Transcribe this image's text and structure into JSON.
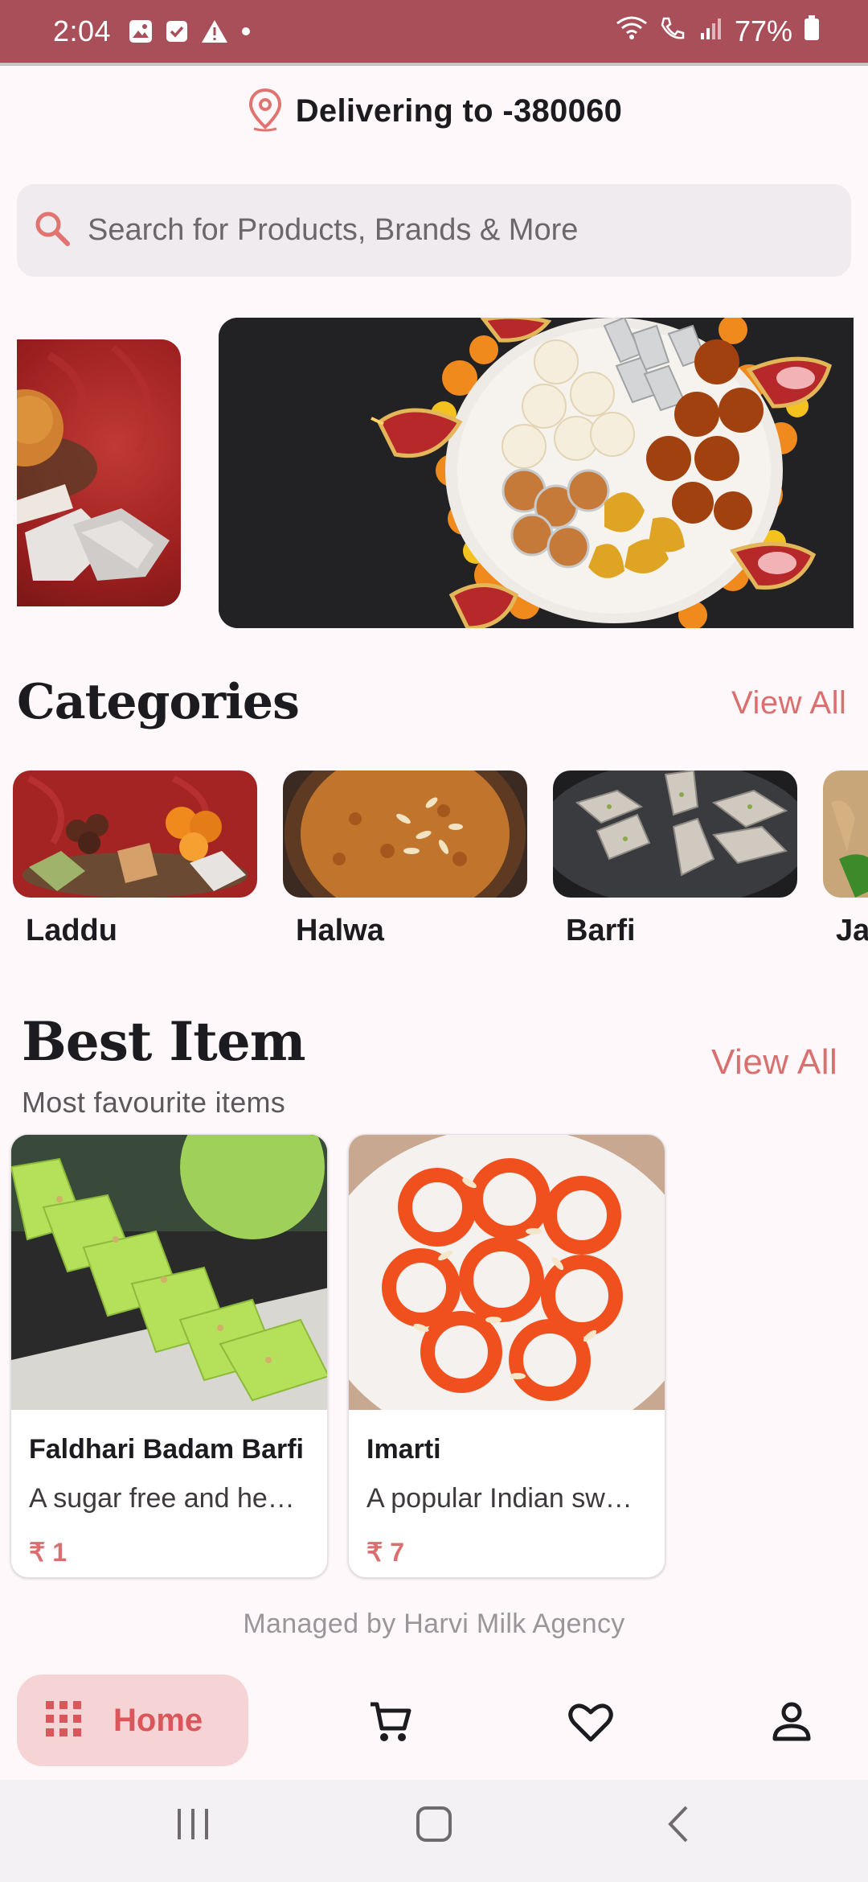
{
  "status_bar": {
    "time": "2:04",
    "battery": "77%",
    "left_icons": [
      "gallery-icon",
      "checkbox-icon",
      "warning-icon",
      "dot-icon"
    ],
    "right_icons": [
      "wifi-icon",
      "call-icon",
      "signal-icon",
      "battery-icon"
    ]
  },
  "location": {
    "text": "Delivering to -380060",
    "icon": "location-pin-icon"
  },
  "search": {
    "placeholder": "Search for Products, Brands & More",
    "icon": "search-icon"
  },
  "categories": {
    "title": "Categories",
    "view_all": "View All",
    "items": [
      {
        "label": "Laddu"
      },
      {
        "label": "Halwa"
      },
      {
        "label": "Barfi"
      },
      {
        "label": "Ja"
      }
    ]
  },
  "best_item": {
    "title": "Best Item",
    "subtitle": "Most favourite items",
    "view_all": "View All",
    "items": [
      {
        "name": "Faldhari Badam Barfi",
        "description": "A sugar free and hea…",
        "price": "₹ 1"
      },
      {
        "name": "Imarti",
        "description": "A popular Indian swe…",
        "price": "₹ 7"
      }
    ]
  },
  "footer": {
    "text": "Managed by Harvi Milk Agency"
  },
  "bottom_nav": {
    "home_label": "Home",
    "items": [
      "grid-icon",
      "cart-icon",
      "heart-icon",
      "person-icon"
    ]
  },
  "colors": {
    "accent": "#d9706f",
    "status_bar": "#a84f5a",
    "home_pill": "#f6d4d6"
  }
}
